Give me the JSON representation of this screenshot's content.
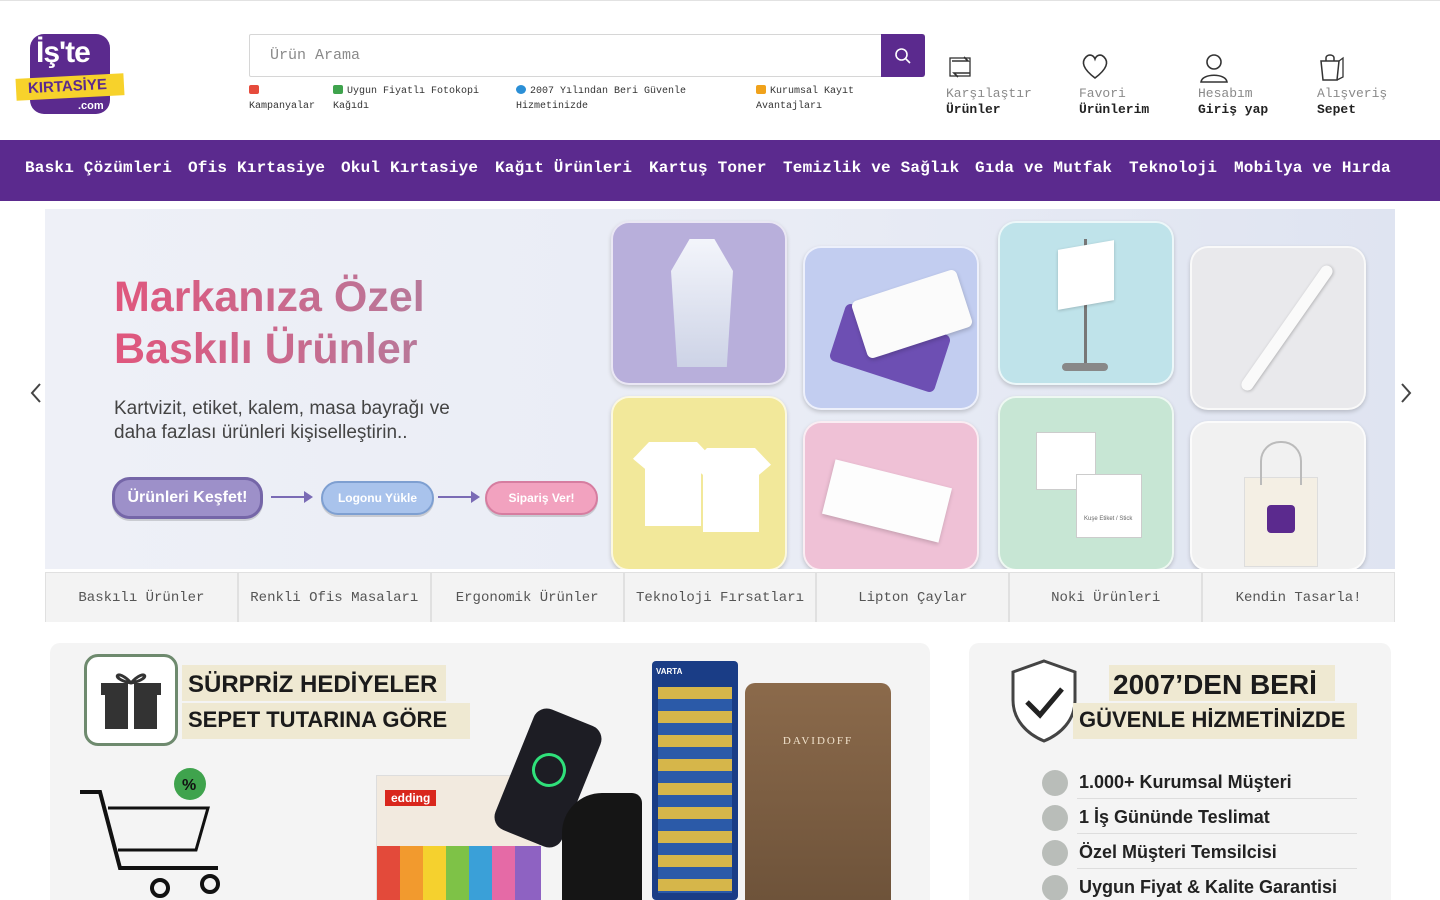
{
  "brand": {
    "logo_top": "İş'te",
    "logo_mid": "KIRTASİYE",
    "logo_bottom": ".com",
    "primary_color": "#5b2a8e",
    "accent_color": "#f7d22b"
  },
  "search": {
    "placeholder": "Ürün Arama",
    "icon": "search-icon"
  },
  "promos": [
    {
      "icon": "gift-icon",
      "text": "Kampanyalar"
    },
    {
      "icon": "money-icon",
      "text": "Uygun Fiyatlı Fotokopi Kağıdı"
    },
    {
      "icon": "globe-icon",
      "text": "2007 Yılından Beri Güvenle Hizmetinizde"
    },
    {
      "icon": "factory-icon",
      "text": "Kurumsal Kayıt Avantajları"
    }
  ],
  "header_actions": [
    {
      "icon": "compare-icon",
      "line1": "Karşılaştır",
      "line2": "Ürünler"
    },
    {
      "icon": "heart-icon",
      "line1": "Favori",
      "line2": "Ürünlerim"
    },
    {
      "icon": "user-icon",
      "line1": "Hesabım",
      "line2": "Giriş yap"
    },
    {
      "icon": "shopping-bag-icon",
      "line1": "Alışveriş",
      "line2": "Sepet"
    }
  ],
  "nav": [
    "Baskı Çözümleri",
    "Ofis Kırtasiye",
    "Okul Kırtasiye",
    "Kağıt Ürünleri",
    "Kartuş Toner",
    "Temizlik ve Sağlık",
    "Gıda ve Mutfak",
    "Teknoloji",
    "Mobilya ve Hırda"
  ],
  "hero": {
    "title_line1": "Markanıza Özel",
    "title_line2": "Baskılı Ürünler",
    "subtitle_line1": "Kartvizit, etiket, kalem, masa bayrağı ve",
    "subtitle_line2": "daha fazlası ürünleri kişiselleştirin..",
    "btn_explore": "Ürünleri Keşfet!",
    "btn_upload": "Logonu Yükle",
    "btn_order": "Sipariş Ver!",
    "product_tile_text": "Kuşe Etiket / Stick"
  },
  "tabs": [
    "Baskılı Ürünler",
    "Renkli Ofis Masaları",
    "Ergonomik Ürünler",
    "Teknoloji Fırsatları",
    "Lipton Çaylar",
    "Noki Ürünleri",
    "Kendin Tasarla!"
  ],
  "banner_left": {
    "headline1": "SÜRPRİZ HEDİYELER",
    "headline2": "SEPET TUTARINA GÖRE",
    "brand_edding": "edding",
    "brand_varta": "VARTA",
    "brand_davidoff": "DAVIDOFF"
  },
  "banner_right": {
    "headline1": "2007’DEN BERİ",
    "headline2": "GÜVENLE HİZMETİNİZDE",
    "features": [
      "1.000+ Kurumsal Müşteri",
      "1 İş Gününde Teslimat",
      "Özel Müşteri Temsilcisi",
      "Uygun Fiyat & Kalite Garantisi"
    ]
  }
}
